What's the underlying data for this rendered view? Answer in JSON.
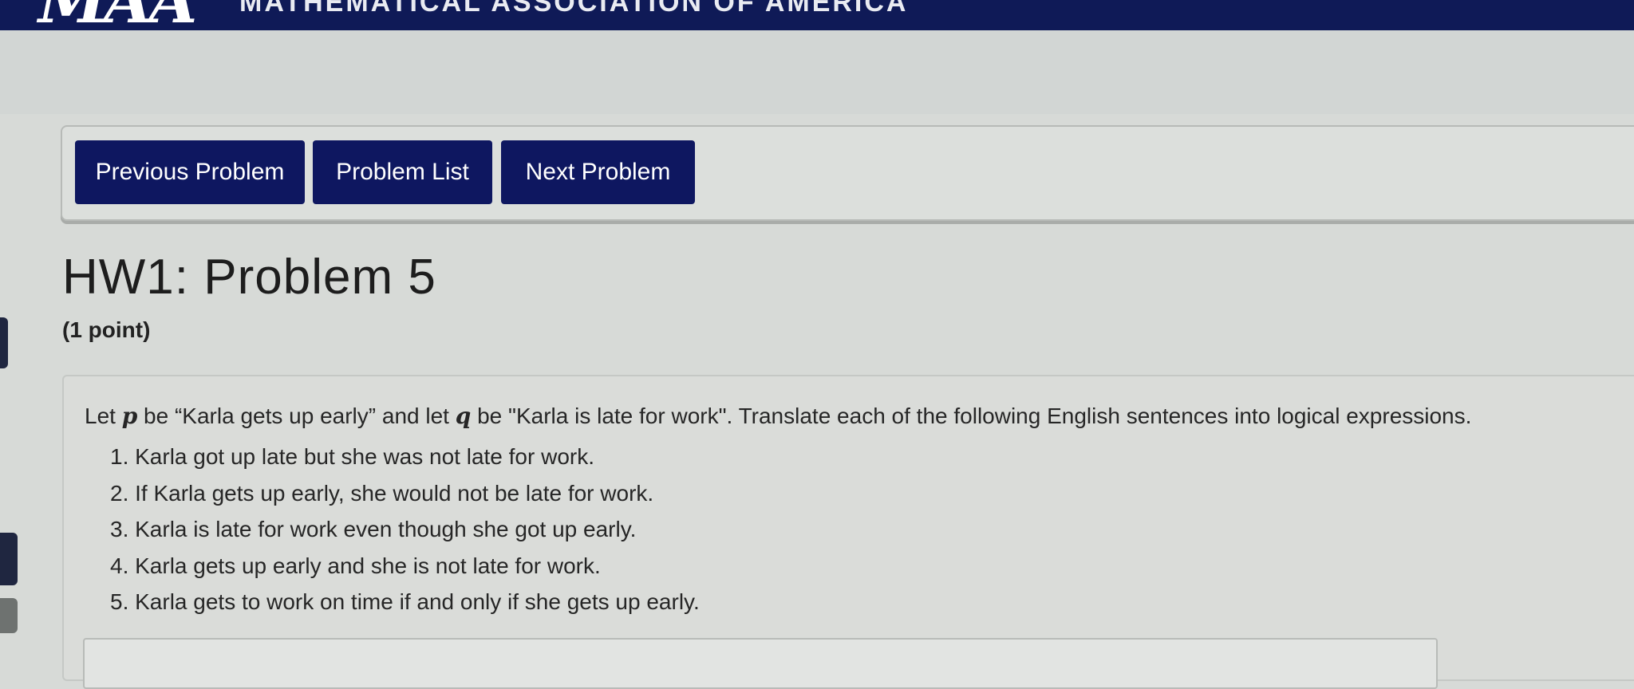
{
  "header": {
    "logo_text": "MAA",
    "org_name": "MATHEMATICAL ASSOCIATION OF AMERICA"
  },
  "nav": {
    "previous_label": "Previous Problem",
    "list_label": "Problem List",
    "next_label": "Next Problem"
  },
  "problem": {
    "title": "HW1: Problem 5",
    "points": "(1 point)",
    "intro_part1": "Let ",
    "var_p": "p",
    "intro_part2": " be “Karla gets up early” and let ",
    "var_q": "q",
    "intro_part3": " be \"Karla is late for work\". Translate each of the following English sentences into logical expressions.",
    "sentences": [
      "1. Karla got up late but she was not late for work.",
      "2. If Karla gets up early, she would not be late for work.",
      "3. Karla is late for work even though she got up early.",
      "4. Karla gets up early and she is not late for work.",
      "5. Karla gets to work on time if and only if she gets up early."
    ]
  },
  "colors": {
    "nav_button_bg": "#0e1760",
    "topbar_bg": "#0f1a57"
  }
}
